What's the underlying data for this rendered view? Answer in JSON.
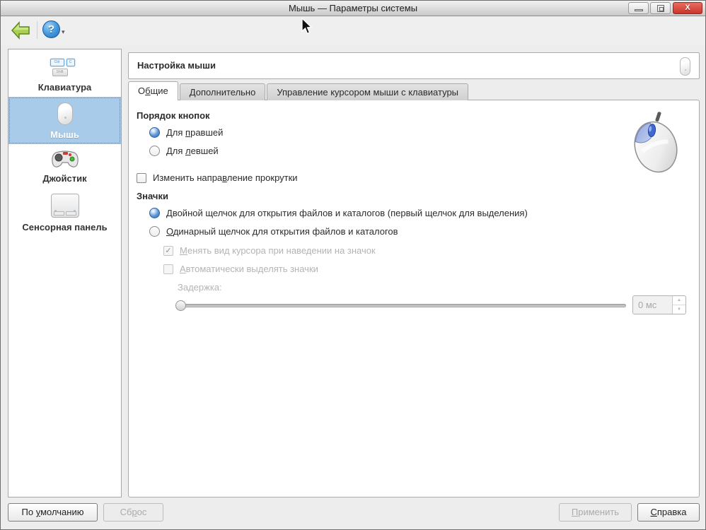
{
  "window": {
    "title": "Мышь — Параметры системы",
    "close_glyph": "X"
  },
  "toolbar": {
    "help_glyph": "?",
    "dropdown_glyph": "▾"
  },
  "sidebar": {
    "keyboard_keys": {
      "ctrl": "Ctrl",
      "c": "C",
      "shift": "Shift"
    },
    "items": [
      {
        "label": "Клавиатура",
        "selected": false
      },
      {
        "label": "Мышь",
        "selected": true
      },
      {
        "label": "Джойстик",
        "selected": false
      },
      {
        "label": "Сенсорная панель",
        "selected": false
      }
    ]
  },
  "header": {
    "title": "Настройка мыши"
  },
  "tabs": [
    {
      "pre": "О",
      "key": "б",
      "post": "щие",
      "active": true
    },
    {
      "label": "Дополнительно",
      "active": false
    },
    {
      "label": "Управление курсором мыши с клавиатуры",
      "active": false
    }
  ],
  "general_tab": {
    "button_order": {
      "title": "Порядок кнопок",
      "right_handed": {
        "pre": "Для ",
        "key": "п",
        "post": "равшей",
        "selected": true
      },
      "left_handed": {
        "pre": "Для ",
        "key": "л",
        "post": "евшей",
        "selected": false
      }
    },
    "reverse_scroll": {
      "pre": "Изменить напра",
      "key": "в",
      "post": "ление прокрутки",
      "checked": false
    },
    "icons": {
      "title": "Значки",
      "double_click": {
        "pre": "",
        "key": "Д",
        "post": "войной щелчок для открытия файлов и каталогов (первый щелчок для выделения)",
        "selected": true
      },
      "single_click": {
        "pre": "",
        "key": "О",
        "post": "динарный щелчок для открытия файлов и каталогов",
        "selected": false
      },
      "change_cursor": {
        "pre": "",
        "key": "М",
        "post": "енять вид курсора при наведении на значок",
        "checked": true,
        "disabled": true,
        "check_glyph": "✓"
      },
      "auto_select": {
        "pre": "",
        "key": "А",
        "post": "втоматически выделять значки",
        "checked": false,
        "disabled": true
      },
      "delay_label": "Задержка:",
      "delay_value": "0 мс",
      "spin_up_glyph": "▲",
      "spin_down_glyph": "▼"
    }
  },
  "footer": {
    "defaults": {
      "pre": "По ",
      "key": "у",
      "post": "молчанию"
    },
    "reset": {
      "pre": "Сб",
      "key": "р",
      "post": "ос"
    },
    "apply": {
      "pre": "",
      "key": "П",
      "post": "рименить"
    },
    "help": {
      "pre": "",
      "key": "С",
      "post": "правка"
    }
  },
  "colors": {
    "selection_blue": "#a8cbe9",
    "radio_blue": "#2f6cb3",
    "close_red": "#c9352b"
  }
}
